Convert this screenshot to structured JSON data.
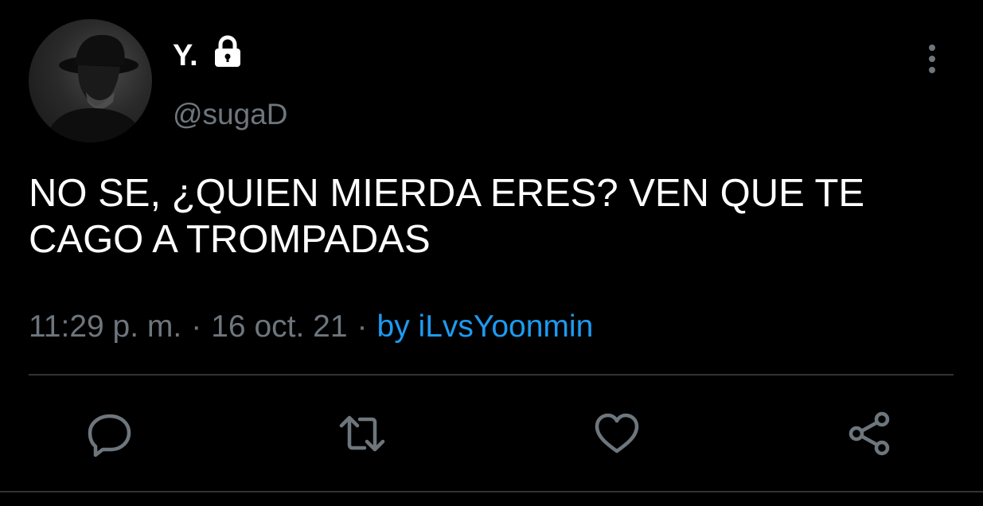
{
  "tweet": {
    "author": {
      "display_name": "Y.",
      "username": "@sugaD",
      "avatar_icon": "avatar-photo",
      "verified_icon": "lock-icon"
    },
    "text": "NO SE, ¿QUIEN MIERDA ERES? VEN QUE TE\nCAGO A TROMPADAS",
    "time": "11:29 p. m.",
    "date": "16 oct. 21",
    "separator": "·",
    "source": "by iLvsYoonmin",
    "actions": [
      {
        "name": "reply",
        "icon": "reply-icon"
      },
      {
        "name": "retweet",
        "icon": "retweet-icon"
      },
      {
        "name": "like",
        "icon": "heart-icon"
      },
      {
        "name": "share",
        "icon": "share-icon"
      }
    ]
  },
  "colors": {
    "background": "#000000",
    "text": "#ffffff",
    "secondary": "#6e767d",
    "link": "#1d9bf0",
    "divider": "#2f3336"
  }
}
